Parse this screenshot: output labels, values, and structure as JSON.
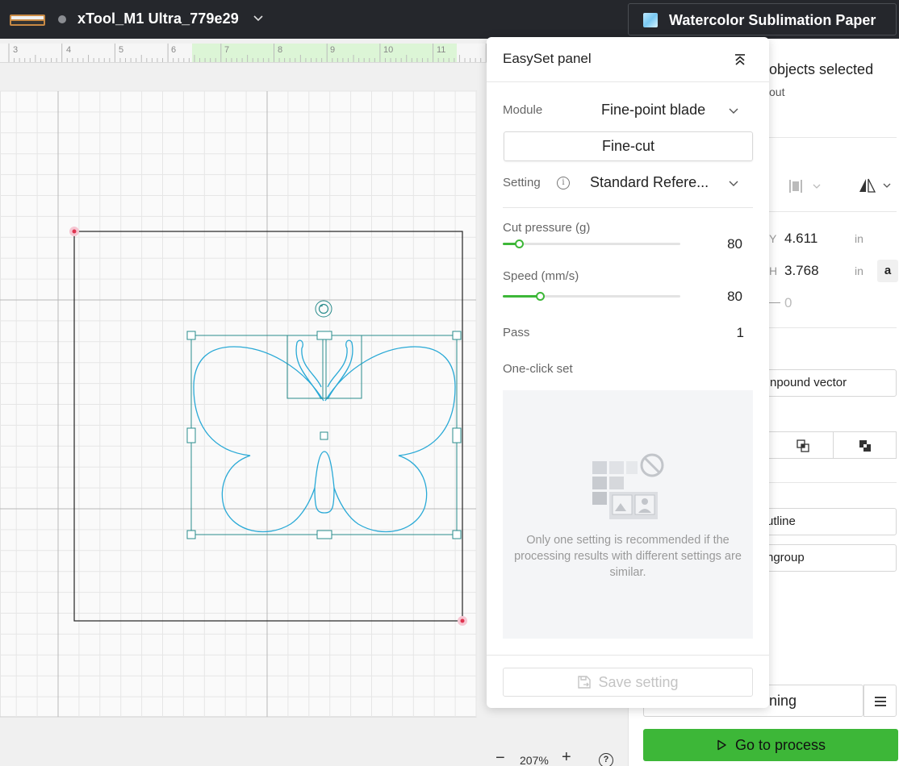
{
  "topbar": {
    "device_name": "xTool_M1 Ultra_779e29",
    "material": "Watercolor Sublimation Paper"
  },
  "ruler": {
    "labels": [
      "3",
      "4",
      "5",
      "6",
      "7",
      "8",
      "9",
      "10",
      "11"
    ]
  },
  "zoom": {
    "value": "207%",
    "minus": "−",
    "plus": "+",
    "help": "?"
  },
  "right_panel": {
    "title": "objects selected",
    "subtitle": "out",
    "y_label": "Y",
    "y_value": "4.611",
    "y_unit": "in",
    "h_label": "H",
    "h_value": "3.768",
    "h_unit": "in",
    "rot_label": "—",
    "rot_value": "0",
    "lock": "a",
    "compound_vector": "npound vector",
    "outline": "utline",
    "ungroup": "ngroup",
    "bottom_select": "ning",
    "process_button": "Go to process"
  },
  "easyset": {
    "title": "EasySet panel",
    "module_label": "Module",
    "module_value": "Fine-point blade",
    "mode_button": "Fine-cut",
    "setting_label": "Setting",
    "setting_value": "Standard Refere...",
    "cut_pressure_label": "Cut pressure (g)",
    "cut_pressure_value": "80",
    "cut_pressure_fraction": 0.09,
    "speed_label": "Speed (mm/s)",
    "speed_value": "80",
    "speed_fraction": 0.21,
    "pass_label": "Pass",
    "pass_value": "1",
    "one_click_label": "One-click set",
    "empty_message": "Only one setting is recommended if the processing results with different settings are similar.",
    "save_button": "Save setting"
  },
  "colors": {
    "topbar_bg": "#25272c",
    "accent_green": "#3db738",
    "selection_teal": "#2a8c8c",
    "shape_blue": "#29a9d6"
  }
}
